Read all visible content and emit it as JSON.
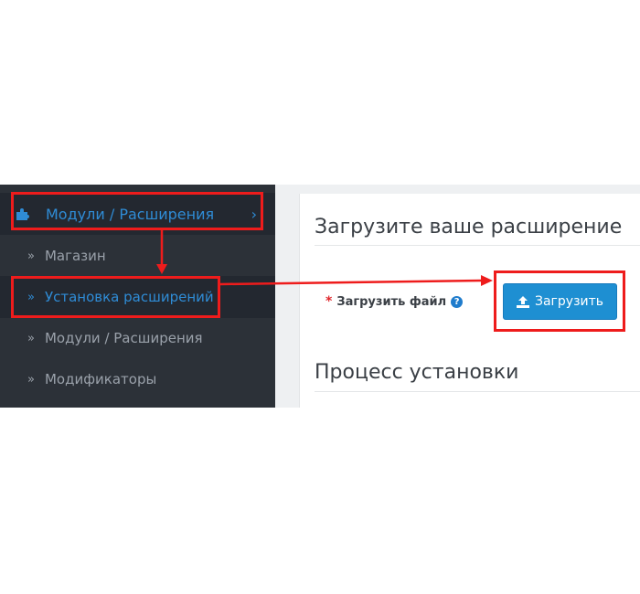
{
  "sidebar": {
    "top_item": {
      "label": "Модули / Расширения",
      "icon": "puzzle-icon",
      "expand_icon": "chevron-right-icon"
    },
    "sub_items": [
      {
        "label": "Магазин",
        "icon": "double-chevron-icon",
        "active": false
      },
      {
        "label": "Установка расширений",
        "icon": "double-chevron-icon",
        "active": true
      },
      {
        "label": "Модули / Расширения",
        "icon": "double-chevron-icon",
        "active": false
      },
      {
        "label": "Модификаторы",
        "icon": "double-chevron-icon",
        "active": false
      }
    ],
    "chevron_glyph": "»",
    "expand_glyph": "›"
  },
  "main": {
    "upload_section_title": "Загрузите ваше расширение",
    "upload_field": {
      "required_mark": "*",
      "label": "Загрузить файл",
      "help_icon": "question-circle-icon",
      "help_glyph": "?"
    },
    "upload_button": {
      "label": "Загрузить",
      "icon": "upload-icon"
    },
    "progress_section_title": "Процесс установки"
  },
  "colors": {
    "sidebar_bg": "#2c3138",
    "sidebar_active_bg": "#232830",
    "accent_blue": "#2f8cd6",
    "button_blue": "#1e8fd2",
    "annotation_red": "#ee1c1c",
    "required_red": "#e0262b"
  }
}
